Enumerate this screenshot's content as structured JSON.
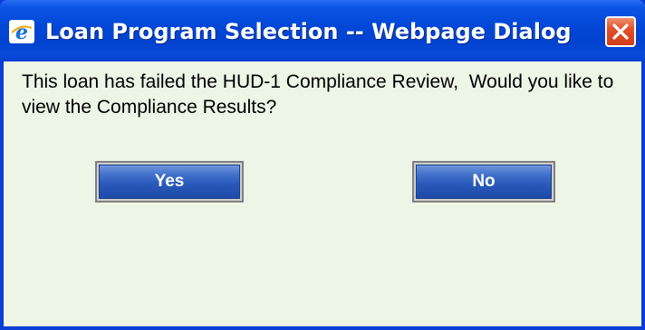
{
  "window": {
    "title": "Loan Program Selection -- Webpage Dialog",
    "icon": "internet-explorer-icon",
    "close_icon": "close-icon"
  },
  "dialog": {
    "message": "This loan has failed the HUD-1 Compliance Review,  Would you like to view the Compliance Results?",
    "yes_label": "Yes",
    "no_label": "No"
  },
  "colors": {
    "titlebar": "#0246d6",
    "client_background": "#ecf5e6",
    "button_blue": "#2858b8",
    "close_red": "#e2512c"
  }
}
